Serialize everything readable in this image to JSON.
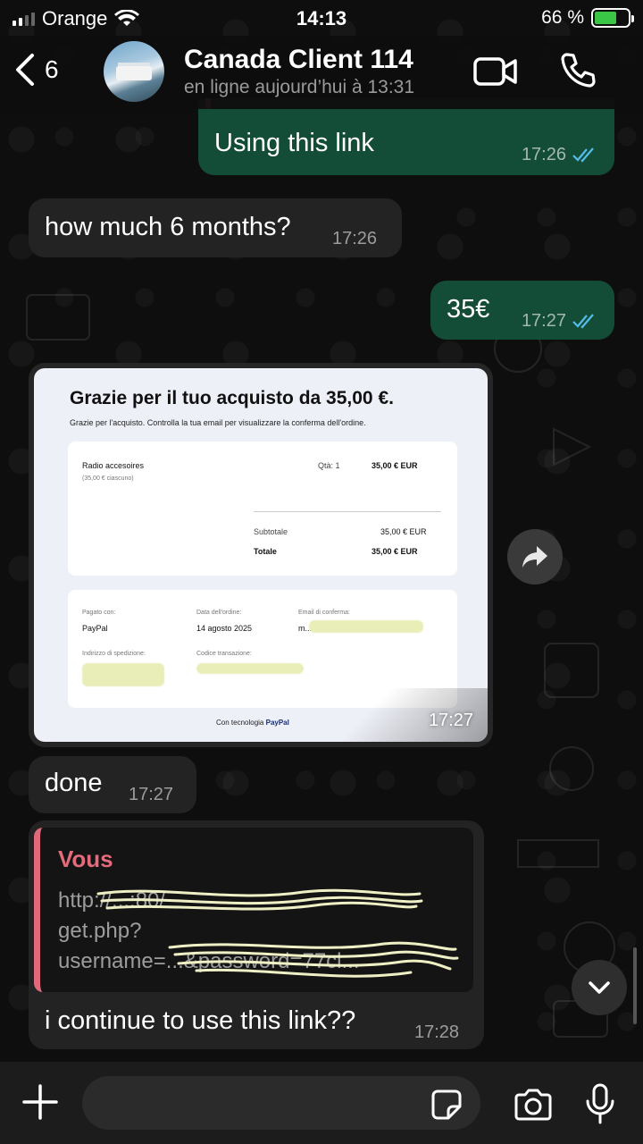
{
  "status_bar": {
    "carrier": "Orange",
    "time": "14:13",
    "battery": "66 %",
    "battery_level": 0.66
  },
  "header": {
    "back_count": "6",
    "contact_name": "Canada Client 114",
    "contact_status": "en ligne aujourd’hui à 13:31"
  },
  "messages": {
    "m1": {
      "text": "Using this link",
      "time": "17:26"
    },
    "m2": {
      "text": "how much 6 months?",
      "time": "17:26"
    },
    "m3": {
      "text": "35€",
      "time": "17:27"
    },
    "m5": {
      "text": "done",
      "time": "17:27"
    },
    "m6": {
      "text": "i continue to use this link??",
      "time": "17:28"
    }
  },
  "receipt": {
    "title": "Grazie per il tuo acquisto da 35,00 €.",
    "subtitle": "Grazie per l'acquisto. Controlla la tua email per visualizzare la conferma dell'ordine.",
    "item_name": "Radio accesoires",
    "item_unit": "(35,00 € ciascuno)",
    "qty": "Qtà: 1",
    "item_price": "35,00 € EUR",
    "subtotal_label": "Subtotale",
    "subtotal_value": "35,00 € EUR",
    "total_label": "Totale",
    "total_value": "35,00 € EUR",
    "paid_with_label": "Pagato con:",
    "paid_with_value": "PayPal",
    "order_date_label": "Data dell'ordine:",
    "order_date_value": "14 agosto 2025",
    "email_label": "Email di conferma:",
    "email_value": "m...",
    "shipping_label": "Indirizzo di spedizione:",
    "transaction_label": "Codice transazione:",
    "powered_by": "Con tecnologia",
    "brand": "PayPal",
    "time": "17:27"
  },
  "quote": {
    "author": "Vous",
    "line1": "http://...:80/",
    "line2": "get.php?",
    "line3": "username=...&password=77cl..."
  },
  "input": {
    "placeholder": ""
  },
  "icons": {
    "back": "chevron-left-icon",
    "video": "video-call-icon",
    "phone": "phone-icon",
    "forward": "forward-icon",
    "scroll": "chevron-down-icon",
    "plus": "plus-icon",
    "sticker": "sticker-icon",
    "camera": "camera-icon",
    "mic": "microphone-icon"
  },
  "colors": {
    "outgoing_bubble": "#144d37",
    "incoming_bubble": "#232323",
    "read_ticks": "#53bdeb",
    "quote_accent": "#e06a7b",
    "battery_fill": "#3ac546"
  }
}
